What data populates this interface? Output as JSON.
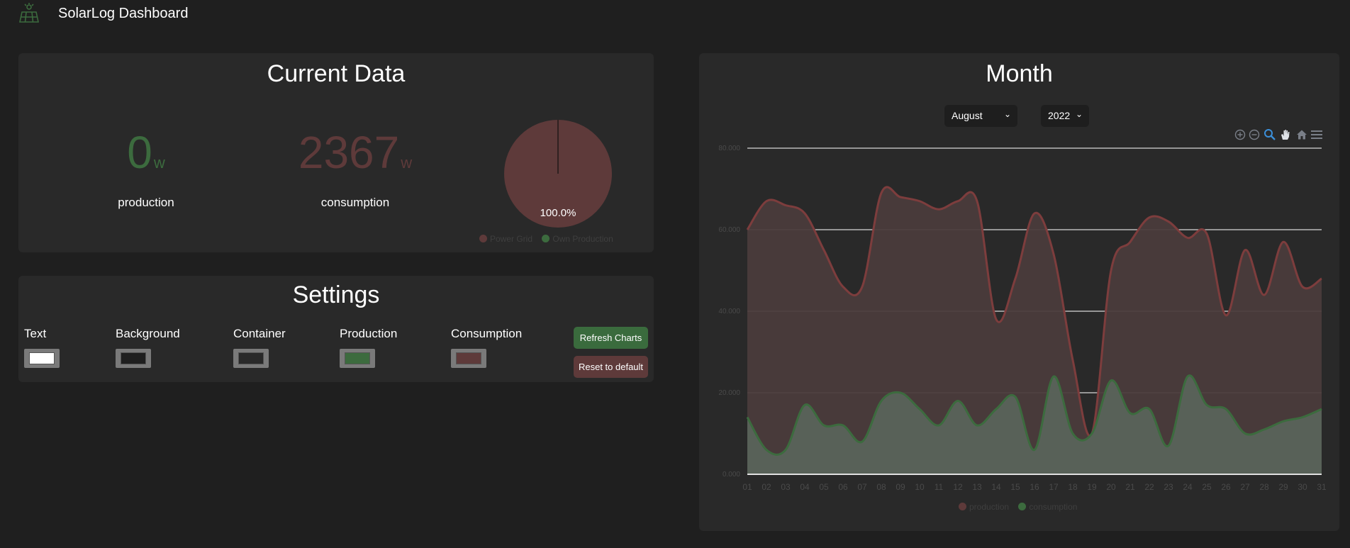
{
  "app": {
    "title": "SolarLog Dashboard",
    "logo_icon": "solar-panel-icon"
  },
  "current": {
    "title": "Current Data",
    "production": {
      "value": "0",
      "unit": "w",
      "label": "production"
    },
    "consumption": {
      "value": "2367",
      "unit": "w",
      "label": "consumption"
    },
    "pie": {
      "label": "100.0%",
      "legend": [
        "Power Grid",
        "Own Production"
      ]
    }
  },
  "settings": {
    "title": "Settings",
    "labels": [
      "Text",
      "Background",
      "Container",
      "Production",
      "Consumption"
    ],
    "refresh_label": "Refresh Charts",
    "reset_label": "Reset to default"
  },
  "month": {
    "title": "Month",
    "month_select": "August",
    "year_select": "2022",
    "toolbar_icons": [
      "zoom-in-icon",
      "zoom-out-icon",
      "zoom-select-icon",
      "pan-icon",
      "home-reset-icon",
      "menu-icon"
    ],
    "legend": [
      "production",
      "consumption"
    ]
  },
  "colors": {
    "production": "#3c6b3e",
    "consumption": "#5e3a3a",
    "text": "#ffffff",
    "background": "#1f1f1f",
    "container": "#292929"
  },
  "chart_data": [
    {
      "type": "pie",
      "categories": [
        "Power Grid",
        "Own Production"
      ],
      "values": [
        100,
        0
      ],
      "data_labels": [
        "100.0%"
      ],
      "legend": "bottom"
    },
    {
      "type": "area",
      "x": [
        "01",
        "02",
        "03",
        "04",
        "05",
        "06",
        "07",
        "08",
        "09",
        "10",
        "11",
        "12",
        "13",
        "14",
        "15",
        "16",
        "17",
        "18",
        "19",
        "20",
        "21",
        "22",
        "23",
        "24",
        "25",
        "26",
        "27",
        "28",
        "29",
        "30",
        "31"
      ],
      "series": [
        {
          "name": "production",
          "values": [
            60,
            67,
            66,
            64,
            55,
            46,
            46,
            69,
            68,
            67,
            65,
            67,
            67,
            38,
            48,
            64,
            54,
            28,
            10,
            50,
            57,
            63,
            62,
            58,
            59,
            39,
            55,
            44,
            57,
            46,
            48
          ]
        },
        {
          "name": "consumption",
          "values": [
            14,
            6,
            6,
            17,
            12,
            12,
            8,
            18,
            20,
            16,
            12,
            18,
            12,
            16,
            19,
            6,
            24,
            10,
            10,
            23,
            15,
            16,
            7,
            24,
            17,
            16,
            10,
            11,
            13,
            14,
            16
          ]
        }
      ],
      "y_ticks": [
        "0.000",
        "20.000",
        "40.000",
        "60.000",
        "80.000"
      ],
      "ylim": [
        0,
        80
      ],
      "grid": true,
      "legend": "bottom"
    }
  ]
}
